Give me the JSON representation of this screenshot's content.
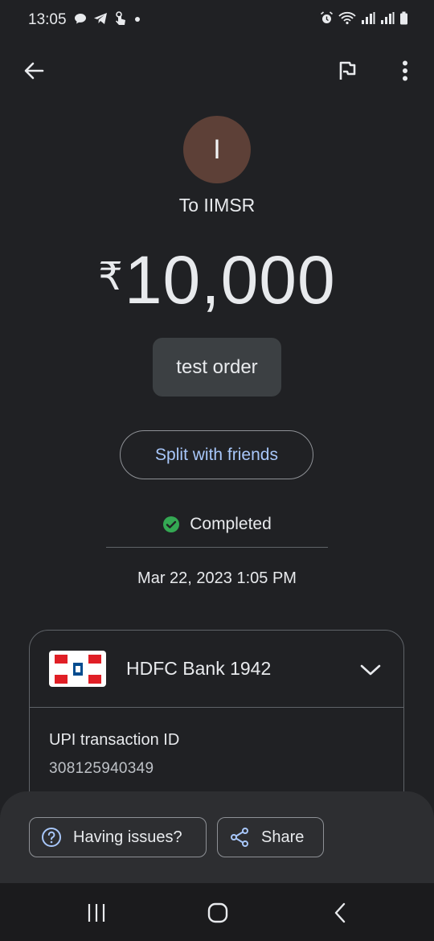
{
  "status_bar": {
    "time": "13:05",
    "left_icons": [
      "chat-bubble-icon",
      "telegram-icon",
      "touch-icon",
      "dot-icon"
    ],
    "right_icons": [
      "alarm-icon",
      "wifi-icon",
      "signal-icon",
      "signal-icon",
      "battery-icon"
    ]
  },
  "app_bar": {
    "back_icon": "arrow-back-icon",
    "flag_icon": "flag-icon",
    "more_icon": "more-vert-icon"
  },
  "payee": {
    "avatar_letter": "I",
    "avatar_color": "#5d4037",
    "label": "To IIMSR"
  },
  "payment": {
    "currency_symbol": "₹",
    "amount": "10,000",
    "note": "test order"
  },
  "split_button": {
    "label": "Split with friends",
    "color": "#a8c7fa"
  },
  "status": {
    "label": "Completed",
    "icon": "check-circle-icon",
    "color": "#34a853"
  },
  "datetime": "Mar 22, 2023 1:05 PM",
  "bank_card": {
    "bank_name": "HDFC Bank 1942",
    "logo": "hdfc-logo",
    "upi_label": "UPI transaction ID",
    "upi_id": "308125940349"
  },
  "bottom_actions": {
    "issues_label": "Having issues?",
    "share_label": "Share"
  },
  "nav_bar": {
    "recents_icon": "recents-icon",
    "home_icon": "home-icon",
    "back_icon": "nav-back-icon"
  }
}
